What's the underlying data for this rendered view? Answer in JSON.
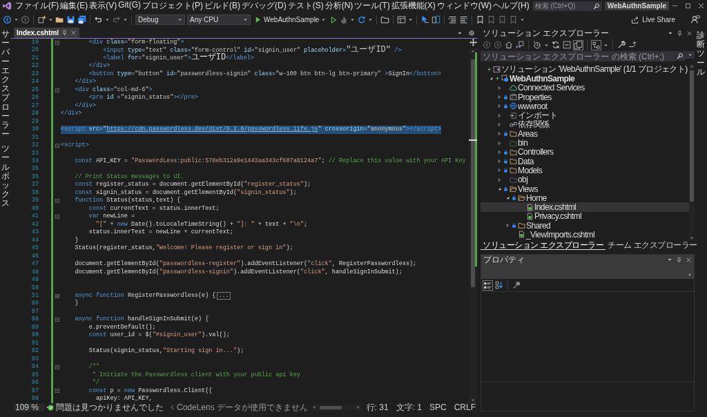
{
  "title_bar": {
    "menus": [
      "ファイル(F)",
      "編集(E)",
      "表示(V)",
      "Git(G)",
      "プロジェクト(P)",
      "ビルド(B)",
      "デバッグ(D)",
      "テスト(S)",
      "分析(N)",
      "ツール(T)",
      "拡張機能(X)",
      "ウィンドウ(W)",
      "ヘルプ(H)"
    ],
    "search": {
      "placeholder": "検索 (Ctrl+Q)"
    },
    "solution_name": "WebAuthnSample"
  },
  "toolbar": {
    "configuration": "Debug",
    "platform": "Any CPU",
    "start_target": "WebAuthnSample",
    "live_share": "Live Share"
  },
  "side_strips": {
    "left": [
      "サーバーエクスプローラー",
      "ツールボックス"
    ],
    "right": [
      "診断ツール"
    ]
  },
  "editor": {
    "tabs": [
      {
        "label": "Index.cshtml",
        "selected": true
      }
    ],
    "lines": [
      {
        "number": "19",
        "expanded": true,
        "selected": false,
        "tokens": [
          {
            "kind": "tag",
            "text": "        <div"
          },
          {
            "kind": "attr",
            "text": " class="
          },
          {
            "kind": "value",
            "text": "\"form-floating\""
          },
          {
            "kind": "tag",
            "text": ">"
          }
        ]
      },
      {
        "number": "20",
        "selected": false,
        "tokens": [
          {
            "kind": "tag",
            "text": "            <input"
          },
          {
            "kind": "attr",
            "text": " type="
          },
          {
            "kind": "value",
            "text": "\"text\""
          },
          {
            "kind": "attr",
            "text": " class="
          },
          {
            "kind": "value",
            "text": "\"form-control\""
          },
          {
            "kind": "attr",
            "text": " id="
          },
          {
            "kind": "value",
            "text": "\"signin_user\""
          },
          {
            "kind": "attr",
            "text": " placeholder="
          },
          {
            "kind": "value",
            "text": "\"ユーザID\""
          },
          {
            "kind": "tag",
            "text": " />"
          }
        ]
      },
      {
        "number": "21",
        "selected": false,
        "tokens": [
          {
            "kind": "tag",
            "text": "            <label"
          },
          {
            "kind": "attr",
            "text": " for="
          },
          {
            "kind": "value",
            "text": "\"signin_user\""
          },
          {
            "kind": "tag",
            "text": ">"
          },
          {
            "kind": "text",
            "text": "ユーザID"
          },
          {
            "kind": "tag",
            "text": "</label>"
          }
        ]
      },
      {
        "number": "22",
        "selected": false,
        "tokens": [
          {
            "kind": "tag",
            "text": "        </div>"
          }
        ]
      },
      {
        "number": "23",
        "selected": false,
        "tokens": [
          {
            "kind": "tag",
            "text": "        <button"
          },
          {
            "kind": "attr",
            "text": " type="
          },
          {
            "kind": "value",
            "text": "\"button\""
          },
          {
            "kind": "attr",
            "text": " id="
          },
          {
            "kind": "value",
            "text": "\"passwordless-signin\""
          },
          {
            "kind": "attr",
            "text": " class="
          },
          {
            "kind": "value",
            "text": "\"w-100 btn btn-lg btn-primary\""
          },
          {
            "kind": "tag",
            "text": " >"
          },
          {
            "kind": "text",
            "text": "SignIn"
          },
          {
            "kind": "tag",
            "text": "</button>"
          }
        ]
      },
      {
        "number": "24",
        "selected": false,
        "tokens": [
          {
            "kind": "tag",
            "text": "    </div>"
          }
        ]
      },
      {
        "number": "25",
        "expanded": true,
        "selected": false,
        "tokens": [
          {
            "kind": "tag",
            "text": "    <div"
          },
          {
            "kind": "attr",
            "text": " class="
          },
          {
            "kind": "value",
            "text": "\"col-md-6\""
          },
          {
            "kind": "tag",
            "text": ">"
          }
        ]
      },
      {
        "number": "26",
        "selected": false,
        "tokens": [
          {
            "kind": "tag",
            "text": "        <pre"
          },
          {
            "kind": "attr",
            "text": " id ="
          },
          {
            "kind": "value",
            "text": "\"signin_status\""
          },
          {
            "kind": "tag",
            "text": "></pre>"
          }
        ]
      },
      {
        "number": "27",
        "selected": false,
        "tokens": [
          {
            "kind": "tag",
            "text": "    </div>"
          }
        ]
      },
      {
        "number": "28",
        "selected": false,
        "tokens": [
          {
            "kind": "tag",
            "text": "</div>"
          }
        ]
      },
      {
        "number": "29",
        "selected": false
      },
      {
        "number": "30",
        "selected": true,
        "tokens": [
          {
            "kind": "tag",
            "text": "<script"
          },
          {
            "kind": "attr",
            "text": " src="
          },
          {
            "kind": "value",
            "text": "\""
          },
          {
            "kind": "link",
            "text": "https://cdn.passwordless.dev/dist/0.2.0/passwordless.iife.js"
          },
          {
            "kind": "value",
            "text": "\""
          },
          {
            "kind": "attr",
            "text": " crossorigin="
          },
          {
            "kind": "value",
            "text": "\"anonymous\""
          },
          {
            "kind": "tag",
            "text": "></script>"
          }
        ]
      },
      {
        "number": "31",
        "selected": false
      },
      {
        "number": "32",
        "expanded": true,
        "selected": false,
        "tokens": [
          {
            "kind": "tag",
            "text": "<script>"
          }
        ]
      },
      {
        "number": "33",
        "selected": false
      },
      {
        "number": "34",
        "selected": false,
        "tokens": [
          {
            "kind": "keyword",
            "text": "    const"
          },
          {
            "kind": "text",
            "text": " API_KEY = "
          },
          {
            "kind": "string",
            "text": "\"PasswordLess:public:578eb312a9e1443aa343cf607a8124a7\""
          },
          {
            "kind": "text",
            "text": "; "
          },
          {
            "kind": "comment",
            "text": "// Replace this value with your API Key"
          }
        ]
      },
      {
        "number": "35",
        "selected": false
      },
      {
        "number": "36",
        "selected": false,
        "tokens": [
          {
            "kind": "comment",
            "text": "    // Print Status messages to UI."
          }
        ]
      },
      {
        "number": "37",
        "selected": false,
        "tokens": [
          {
            "kind": "keyword",
            "text": "    const"
          },
          {
            "kind": "text",
            "text": " register_status = document.getElementById("
          },
          {
            "kind": "string",
            "text": "\"register_status\""
          },
          {
            "kind": "text",
            "text": ");"
          }
        ]
      },
      {
        "number": "38",
        "selected": false,
        "tokens": [
          {
            "kind": "keyword",
            "text": "    const"
          },
          {
            "kind": "text",
            "text": " signin_status = document.getElementById("
          },
          {
            "kind": "string",
            "text": "\"signin_status\""
          },
          {
            "kind": "text",
            "text": ");"
          }
        ]
      },
      {
        "number": "39",
        "expanded": true,
        "selected": false,
        "tokens": [
          {
            "kind": "keyword",
            "text": "    function"
          },
          {
            "kind": "text",
            "text": " Status(status,text) {"
          }
        ]
      },
      {
        "number": "40",
        "selected": false,
        "tokens": [
          {
            "kind": "keyword",
            "text": "        const"
          },
          {
            "kind": "text",
            "text": " currentText = status.innerText;"
          }
        ]
      },
      {
        "number": "41",
        "expanded": true,
        "selected": false,
        "tokens": [
          {
            "kind": "keyword",
            "text": "        var"
          },
          {
            "kind": "text",
            "text": " newLine ="
          }
        ]
      },
      {
        "number": "42",
        "selected": false,
        "tokens": [
          {
            "kind": "string",
            "text": "          \"[\""
          },
          {
            "kind": "text",
            "text": " + "
          },
          {
            "kind": "keyword",
            "text": "new"
          },
          {
            "kind": "text",
            "text": " Date().toLocaleTimeString() + "
          },
          {
            "kind": "string",
            "text": "\"]: \""
          },
          {
            "kind": "text",
            "text": " + text + "
          },
          {
            "kind": "string",
            "text": "\"\\n\""
          },
          {
            "kind": "text",
            "text": ";"
          }
        ]
      },
      {
        "number": "43",
        "selected": false,
        "tokens": [
          {
            "kind": "text",
            "text": "        status.innerText = newLine + currentText;"
          }
        ]
      },
      {
        "number": "44",
        "selected": false,
        "tokens": [
          {
            "kind": "text",
            "text": "    }"
          }
        ]
      },
      {
        "number": "45",
        "selected": false,
        "tokens": [
          {
            "kind": "text",
            "text": "    Status(register_status,"
          },
          {
            "kind": "string",
            "text": "\"Welcome! Please register or sign in\""
          },
          {
            "kind": "text",
            "text": ");"
          }
        ]
      },
      {
        "number": "46",
        "selected": false
      },
      {
        "number": "47",
        "selected": false,
        "tokens": [
          {
            "kind": "text",
            "text": "    document.getElementById("
          },
          {
            "kind": "string",
            "text": "\"passwordless-register\""
          },
          {
            "kind": "text",
            "text": ").addEventListener("
          },
          {
            "kind": "string",
            "text": "\"click\""
          },
          {
            "kind": "text",
            "text": ", RegisterPasswordless);"
          }
        ]
      },
      {
        "number": "48",
        "selected": false,
        "tokens": [
          {
            "kind": "text",
            "text": "    document.getElementById("
          },
          {
            "kind": "string",
            "text": "\"passwordless-signin\""
          },
          {
            "kind": "text",
            "text": ").addEventListener("
          },
          {
            "kind": "string",
            "text": "\"click\""
          },
          {
            "kind": "text",
            "text": ", handleSignInSubmit);"
          }
        ]
      },
      {
        "number": "49",
        "selected": false
      },
      {
        "number": "50",
        "selected": false
      },
      {
        "number": "51",
        "expanded": false,
        "selected": false,
        "collapsed_text": "...",
        "tokens": [
          {
            "kind": "keyword",
            "text": "    async function"
          },
          {
            "kind": "text",
            "text": " RegisterPasswordless(e) {"
          }
        ]
      },
      {
        "number": "86",
        "selected": false,
        "tokens": [
          {
            "kind": "text",
            "text": "    }"
          }
        ]
      },
      {
        "number": "87",
        "selected": false
      },
      {
        "number": "88",
        "expanded": true,
        "selected": false,
        "tokens": [
          {
            "kind": "keyword",
            "text": "    async function"
          },
          {
            "kind": "text",
            "text": " handleSignInSubmit(e) {"
          }
        ]
      },
      {
        "number": "89",
        "selected": false,
        "tokens": [
          {
            "kind": "text",
            "text": "        e.preventDefault();"
          }
        ]
      },
      {
        "number": "90",
        "selected": false,
        "tokens": [
          {
            "kind": "keyword",
            "text": "        const"
          },
          {
            "kind": "text",
            "text": " user_id = $("
          },
          {
            "kind": "string",
            "text": "\"#signin_user\""
          },
          {
            "kind": "text",
            "text": ").val();"
          }
        ]
      },
      {
        "number": "91",
        "selected": false
      },
      {
        "number": "92",
        "selected": false,
        "tokens": [
          {
            "kind": "text",
            "text": "        Status(signin_status,"
          },
          {
            "kind": "string",
            "text": "\"Starting sign in...\""
          },
          {
            "kind": "text",
            "text": ");"
          }
        ]
      },
      {
        "number": "93",
        "selected": false
      },
      {
        "number": "94",
        "expanded": true,
        "selected": false,
        "tokens": [
          {
            "kind": "comment",
            "text": "        /**"
          }
        ]
      },
      {
        "number": "95",
        "selected": false,
        "tokens": [
          {
            "kind": "comment",
            "text": "         * Initiate the Passwordless client with your public api key"
          }
        ]
      },
      {
        "number": "96",
        "selected": false,
        "tokens": [
          {
            "kind": "comment",
            "text": "         */"
          }
        ]
      },
      {
        "number": "97",
        "expanded": true,
        "selected": false,
        "tokens": [
          {
            "kind": "keyword",
            "text": "        const"
          },
          {
            "kind": "text",
            "text": " p = "
          },
          {
            "kind": "keyword",
            "text": "new"
          },
          {
            "kind": "text",
            "text": " Passwordless.Client({"
          }
        ]
      },
      {
        "number": "98",
        "selected": false,
        "tokens": [
          {
            "kind": "text",
            "text": "          apiKey: API_KEY,"
          }
        ]
      }
    ],
    "status": {
      "zoom": "109 %",
      "issues": "問題は見つかりませんでした",
      "codelens": "CodeLens データが使用できません",
      "line": "行: 31",
      "column": "文字: 1",
      "indent": "SPC",
      "line_ending": "CRLF"
    }
  },
  "solution_explorer": {
    "title": "ソリューション エクスプローラー",
    "search": {
      "placeholder": "ソリューション エクスプローラー の検索 (Ctrl+;)"
    },
    "tree": [
      {
        "label": "ソリューション 'WebAuthnSample' (1/1 プロジェクト)",
        "kind": "solution",
        "added": true,
        "locked": false,
        "selected": false,
        "children": [
          {
            "label": "WebAuthnSample",
            "kind": "project",
            "added": true,
            "locked": false,
            "expanded": true,
            "selected": false,
            "children": [
              {
                "label": "Connected Services",
                "kind": "service",
                "added": false,
                "locked": false,
                "expanded": false,
                "selected": false
              },
              {
                "label": "Properties",
                "kind": "properties",
                "added": false,
                "locked": true,
                "expanded": false,
                "selected": false
              },
              {
                "label": "wwwroot",
                "kind": "web",
                "added": false,
                "locked": true,
                "expanded": false,
                "selected": false
              },
              {
                "label": "インポート",
                "kind": "import",
                "added": false,
                "locked": false,
                "expanded": false,
                "selected": false
              },
              {
                "label": "依存関係",
                "kind": "deps",
                "added": false,
                "locked": false,
                "expanded": false,
                "selected": false
              },
              {
                "label": "Areas",
                "kind": "folder",
                "added": false,
                "locked": true,
                "expanded": false,
                "selected": false
              },
              {
                "label": "bin",
                "kind": "hidden-folder",
                "added": false,
                "locked": false,
                "expanded": false,
                "selected": false
              },
              {
                "label": "Controllers",
                "kind": "folder",
                "added": false,
                "locked": true,
                "expanded": false,
                "selected": false
              },
              {
                "label": "Data",
                "kind": "folder",
                "added": false,
                "locked": true,
                "expanded": false,
                "selected": false
              },
              {
                "label": "Models",
                "kind": "folder",
                "added": false,
                "locked": true,
                "expanded": false,
                "selected": false
              },
              {
                "label": "obj",
                "kind": "hidden-folder",
                "added": false,
                "locked": false,
                "expanded": false,
                "selected": false
              },
              {
                "label": "Views",
                "kind": "folder",
                "added": false,
                "locked": true,
                "expanded": true,
                "selected": false,
                "children": [
                  {
                    "label": "Home",
                    "kind": "folder",
                    "added": false,
                    "locked": true,
                    "expanded": true,
                    "selected": false,
                    "children": [
                      {
                        "label": "Index.cshtml",
                        "kind": "page",
                        "added": false,
                        "locked": false,
                        "selected": true
                      },
                      {
                        "label": "Privacy.cshtml",
                        "kind": "page",
                        "added": false,
                        "locked": false,
                        "selected": false
                      }
                    ]
                  },
                  {
                    "label": "Shared",
                    "kind": "folder",
                    "added": false,
                    "locked": true,
                    "expanded": false,
                    "selected": false
                  },
                  {
                    "label": "_ViewImports.cshtml",
                    "kind": "page",
                    "added": false,
                    "locked": false,
                    "selected": false
                  }
                ]
              }
            ]
          }
        ]
      }
    ],
    "tabs": [
      {
        "label": "ソリューション エクスプローラー",
        "selected": true
      },
      {
        "label": "チーム エクスプローラー",
        "selected": false
      }
    ]
  },
  "properties": {
    "title": "プロパティ"
  }
}
